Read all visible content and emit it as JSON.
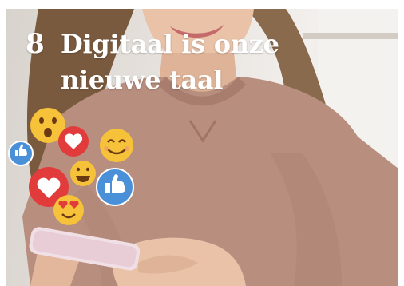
{
  "headline": {
    "number": "8",
    "line1": "Digitaal is onze",
    "line2": "nieuwe taal"
  },
  "photo": {
    "subject": "woman-in-pink-sweatshirt-using-phone",
    "colors": {
      "sweater": "#b88e7f",
      "hair": "#7a5a3e",
      "skin": "#e9c2a8",
      "phone": "#f1dfe6"
    }
  },
  "reactions": [
    {
      "icon": "thumbs-up-icon",
      "color": "#4a90d9"
    },
    {
      "icon": "surprised-face-icon",
      "color": "#f5c23a"
    },
    {
      "icon": "heart-icon",
      "color": "#e23b3b"
    },
    {
      "icon": "smiling-face-icon",
      "color": "#f5c23a"
    },
    {
      "icon": "heart-icon",
      "color": "#e23b3b"
    },
    {
      "icon": "grinning-face-icon",
      "color": "#f5c23a"
    },
    {
      "icon": "thumbs-up-icon",
      "color": "#4a90d9"
    },
    {
      "icon": "heart-eyes-face-icon",
      "color": "#f5c23a"
    }
  ]
}
